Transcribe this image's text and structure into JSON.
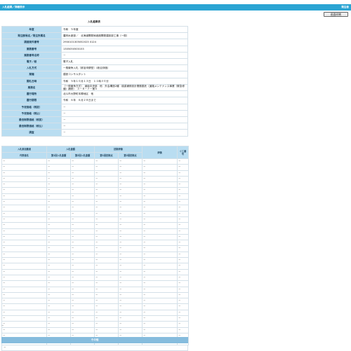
{
  "header": {
    "title": "入札結果／詳細表示",
    "right": "発注者"
  },
  "print_button": "画面印刷",
  "heading": "入札結果表",
  "details": [
    {
      "label": "年度",
      "value": "令和　５年度"
    },
    {
      "label": "発注部局名／発注所属名",
      "value": "農林水産部／　北海道開発局函館開発建設部工事（一般）"
    },
    {
      "label": "調達案件番号",
      "value": "2900101305052023 0124"
    },
    {
      "label": "業務番号",
      "value": "1305050500153"
    },
    {
      "label": "業務番号名称",
      "value": "－"
    },
    {
      "label": "電子／紙",
      "value": "電子入札"
    },
    {
      "label": "入札方式",
      "value": "一般競争入札［参加申請型］（総合評価）"
    },
    {
      "label": "業種",
      "value": "建設コンサルタント"
    },
    {
      "label": "開札日時",
      "value": "令和　５年１０月１３日　１１時３０分"
    },
    {
      "label": "業務名",
      "value": "［一般競争方式］　道南中央部　他　外会構造2種　橋梁補修設計業務委託（道路メンテナンス事業（緊急修繕）補修）　３－８－７－第５"
    },
    {
      "label": "履行場所",
      "value": "北斗市大野町本郷地区　他"
    },
    {
      "label": "履行期限",
      "value": "令和　６年　６月２８日まで"
    },
    {
      "label": "予定価格（税抜）",
      "value": "－"
    },
    {
      "label": "予定価格（税込）",
      "value": "－"
    },
    {
      "label": "最低制限価格（税抜）",
      "value": "－"
    },
    {
      "label": "最低制限価格（税込）",
      "value": "－"
    },
    {
      "label": "調査",
      "value": "－"
    }
  ],
  "bid_table": {
    "headers": {
      "participant": "入札参加業者",
      "bid_amount": "入札金額",
      "tech_eval": "技術評価",
      "evaluation": "評価",
      "rank": "くじ番号",
      "name": "代表者名",
      "first_bid": "第1回入札金額",
      "second_bid": "第2回入札金額",
      "first_score": "第1回技術点",
      "second_score": "第2回技術点"
    },
    "rows": [
      [
        "－",
        "－",
        "－",
        "－",
        "－",
        "－",
        "－"
      ],
      [
        "－",
        "－",
        "－",
        "－",
        "－",
        "－",
        "－"
      ],
      [
        "－",
        "－",
        "－",
        "－",
        "－",
        "－",
        "－"
      ],
      [
        "－",
        "－",
        "－",
        "－",
        "－",
        "－",
        "－"
      ],
      [
        "－",
        "－",
        "－",
        "－",
        "－",
        "－",
        "－"
      ],
      [
        "－",
        "－",
        "－",
        "－",
        "－",
        "－",
        "－"
      ],
      [
        "－",
        "－",
        "－",
        "－",
        "－",
        "－",
        "－"
      ],
      [
        "－",
        "－",
        "－",
        "－",
        "－",
        "－",
        "－"
      ],
      [
        "－",
        "－",
        "－",
        "－",
        "－",
        "－",
        "－"
      ],
      [
        "－",
        "－",
        "－",
        "－",
        "－",
        "－",
        "－"
      ],
      [
        "－",
        "－",
        "－",
        "－",
        "－",
        "－",
        "－"
      ],
      [
        "－",
        "－",
        "－",
        "－",
        "－",
        "－",
        "－"
      ],
      [
        "－",
        "－",
        "－",
        "－",
        "－",
        "－",
        "－"
      ],
      [
        "－",
        "－",
        "－",
        "－",
        "－",
        "－",
        "－"
      ],
      [
        "－",
        "－",
        "－",
        "－",
        "－",
        "－",
        "－"
      ],
      [
        "－",
        "－",
        "－",
        "－",
        "－",
        "－",
        "－"
      ],
      [
        "－",
        "－",
        "－",
        "－",
        "－",
        "－",
        "－"
      ],
      [
        "－",
        "－",
        "－",
        "－",
        "－",
        "－",
        "－"
      ],
      [
        "－",
        "－",
        "－",
        "－",
        "－",
        "－",
        "－"
      ],
      [
        "－",
        "－",
        "－",
        "－",
        "－",
        "－",
        "－"
      ],
      [
        "－",
        "－",
        "－",
        "－",
        "－",
        "－",
        "－"
      ],
      [
        "－",
        "－",
        "－",
        "－",
        "－",
        "－",
        "－"
      ],
      [
        "－",
        "－",
        "－",
        "－",
        "－",
        "－",
        "－"
      ],
      [
        "－",
        "－",
        "－",
        "－",
        "－",
        "－",
        "－"
      ],
      [
        "－",
        "－",
        "－",
        "－",
        "－",
        "－",
        "－"
      ],
      [
        "－",
        "－",
        "－",
        "－",
        "－",
        "－",
        "－"
      ],
      [
        "－",
        "－",
        "－",
        "－",
        "－",
        "－",
        "－"
      ],
      [
        "－",
        "－",
        "－",
        "－",
        "－",
        "－",
        "－"
      ],
      [
        "－",
        "－",
        "－",
        "－",
        "－",
        "－",
        "－"
      ],
      [
        "－",
        "－",
        "－",
        "－",
        "－",
        "－",
        "－"
      ],
      [
        "－",
        "－",
        "－",
        "－",
        "－",
        "－",
        "－"
      ],
      [
        "－",
        "－",
        "－",
        "－",
        "－",
        "－",
        "－"
      ]
    ]
  },
  "blank_row": "－",
  "other_section": {
    "title": "その他",
    "value": "－"
  }
}
